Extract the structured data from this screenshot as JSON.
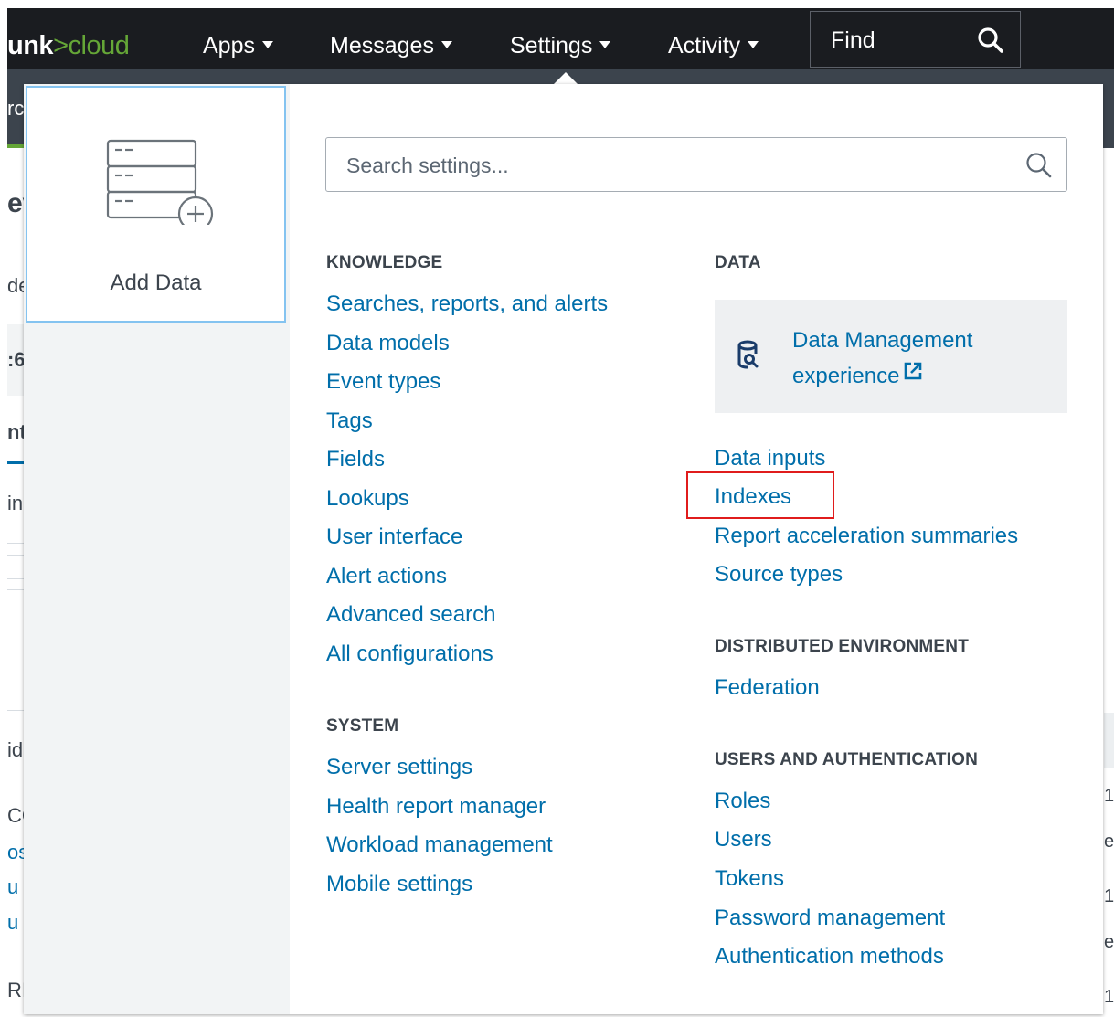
{
  "topbar": {
    "brand_prefix": "unk",
    "brand_sep": ">",
    "brand_suffix": "cloud",
    "nav": [
      {
        "label": "Apps"
      },
      {
        "label": "Messages"
      },
      {
        "label": "Settings"
      },
      {
        "label": "Activity"
      }
    ],
    "find_label": "Find",
    "find_icon": "search-icon"
  },
  "background_fragments": {
    "a": "rc",
    "b": "ev",
    "c": "de",
    "d": ":6",
    "e": "nt",
    "f": "in",
    "g": "id",
    "h": "CC",
    "i": "os",
    "j": "u",
    "k": "u",
    "l": "RI",
    "r1": "1",
    "r2": "e",
    "r3": "1",
    "r4": "e",
    "r5": "1"
  },
  "panel": {
    "add_data": {
      "label": "Add Data",
      "icon": "add-data-icon"
    },
    "search": {
      "placeholder": "Search settings...",
      "value": "",
      "icon": "search-icon"
    },
    "knowledge": {
      "heading": "KNOWLEDGE",
      "items": [
        "Searches, reports, and alerts",
        "Data models",
        "Event types",
        "Tags",
        "Fields",
        "Lookups",
        "User interface",
        "Alert actions",
        "Advanced search",
        "All configurations"
      ]
    },
    "system": {
      "heading": "SYSTEM",
      "items": [
        "Server settings",
        "Health report manager",
        "Workload management",
        "Mobile settings"
      ]
    },
    "data": {
      "heading": "DATA",
      "dm_line1": "Data Management",
      "dm_line2": "experience",
      "dm_icon": "data-management-icon",
      "external_icon": "external-link-icon",
      "items": [
        "Data inputs",
        "Indexes",
        "Report acceleration summaries",
        "Source types"
      ]
    },
    "distributed": {
      "heading": "DISTRIBUTED ENVIRONMENT",
      "items": [
        "Federation"
      ]
    },
    "users": {
      "heading": "USERS AND AUTHENTICATION",
      "items": [
        "Roles",
        "Users",
        "Tokens",
        "Password management",
        "Authentication methods"
      ]
    },
    "highlight_color": "#e01c1c",
    "link_color": "#006eaa"
  }
}
